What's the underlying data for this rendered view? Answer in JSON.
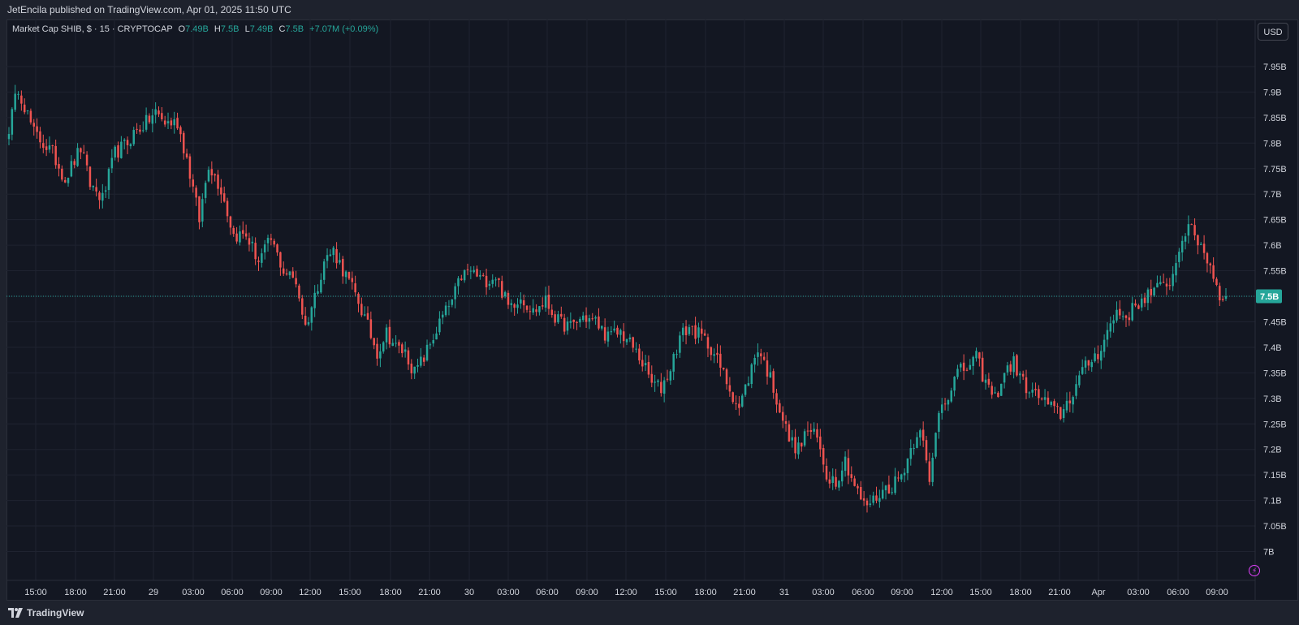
{
  "header": {
    "publisher_text": "JetEncila published on TradingView.com, Apr 01, 2025 11:50 UTC"
  },
  "legend": {
    "symbol": "Market Cap SHIB, $ · 15 · CRYPTOCAP",
    "o_label": "O",
    "o_value": "7.49B",
    "h_label": "H",
    "h_value": "7.5B",
    "l_label": "L",
    "l_value": "7.49B",
    "c_label": "C",
    "c_value": "7.5B",
    "change": "+7.07M (+0.09%)"
  },
  "currency_button": "USD",
  "footer": {
    "brand": "TradingView"
  },
  "colors": {
    "up": "#26a69a",
    "down": "#ef5350",
    "background": "#131722",
    "grid": "#1f2330",
    "text": "#d1d4dc"
  },
  "chart_data": {
    "type": "candlestick",
    "title": "Market Cap SHIB, $ · 15 · CRYPTOCAP",
    "y_unit": "B",
    "ylim": [
      6.97,
      8.01
    ],
    "y_ticks": [
      7.0,
      7.05,
      7.1,
      7.15,
      7.2,
      7.25,
      7.3,
      7.35,
      7.4,
      7.45,
      7.5,
      7.55,
      7.6,
      7.65,
      7.7,
      7.75,
      7.8,
      7.85,
      7.9,
      7.95
    ],
    "y_tick_labels": [
      "7B",
      "7.05B",
      "7.1B",
      "7.15B",
      "7.2B",
      "7.25B",
      "7.3B",
      "7.35B",
      "7.4B",
      "7.45B",
      "7.5B",
      "7.55B",
      "7.6B",
      "7.65B",
      "7.7B",
      "7.75B",
      "7.8B",
      "7.85B",
      "7.9B",
      "7.95B"
    ],
    "x_tick_labels": [
      "15:00",
      "18:00",
      "21:00",
      "29",
      "03:00",
      "06:00",
      "09:00",
      "12:00",
      "15:00",
      "18:00",
      "21:00",
      "30",
      "03:00",
      "06:00",
      "09:00",
      "12:00",
      "15:00",
      "18:00",
      "21:00",
      "31",
      "03:00",
      "06:00",
      "09:00",
      "12:00",
      "15:00",
      "18:00",
      "21:00",
      "Apr",
      "03:00",
      "06:00",
      "09:00"
    ],
    "last_price": 7.5,
    "last_price_label": "7.5B",
    "grid": true,
    "close_path": [
      [
        0,
        7.83
      ],
      [
        3,
        7.91
      ],
      [
        8,
        7.82
      ],
      [
        14,
        7.78
      ],
      [
        18,
        7.73
      ],
      [
        23,
        7.79
      ],
      [
        26,
        7.72
      ],
      [
        30,
        7.69
      ],
      [
        34,
        7.78
      ],
      [
        38,
        7.8
      ],
      [
        40,
        7.82
      ],
      [
        44,
        7.84
      ],
      [
        47,
        7.86
      ],
      [
        50,
        7.84
      ],
      [
        54,
        7.84
      ],
      [
        57,
        7.77
      ],
      [
        61,
        7.65
      ],
      [
        64,
        7.76
      ],
      [
        68,
        7.71
      ],
      [
        72,
        7.62
      ],
      [
        76,
        7.62
      ],
      [
        80,
        7.57
      ],
      [
        84,
        7.61
      ],
      [
        88,
        7.55
      ],
      [
        92,
        7.53
      ],
      [
        95,
        7.44
      ],
      [
        98,
        7.5
      ],
      [
        101,
        7.57
      ],
      [
        104,
        7.59
      ],
      [
        108,
        7.54
      ],
      [
        112,
        7.49
      ],
      [
        115,
        7.44
      ],
      [
        118,
        7.39
      ],
      [
        121,
        7.43
      ],
      [
        124,
        7.4
      ],
      [
        127,
        7.39
      ],
      [
        130,
        7.35
      ],
      [
        133,
        7.38
      ],
      [
        136,
        7.42
      ],
      [
        139,
        7.46
      ],
      [
        142,
        7.49
      ],
      [
        145,
        7.54
      ],
      [
        148,
        7.55
      ],
      [
        152,
        7.53
      ],
      [
        156,
        7.54
      ],
      [
        160,
        7.48
      ],
      [
        164,
        7.5
      ],
      [
        168,
        7.47
      ],
      [
        172,
        7.49
      ],
      [
        176,
        7.45
      ],
      [
        180,
        7.44
      ],
      [
        184,
        7.46
      ],
      [
        188,
        7.45
      ],
      [
        192,
        7.42
      ],
      [
        196,
        7.43
      ],
      [
        200,
        7.4
      ],
      [
        203,
        7.37
      ],
      [
        206,
        7.33
      ],
      [
        209,
        7.32
      ],
      [
        212,
        7.36
      ],
      [
        215,
        7.42
      ],
      [
        218,
        7.44
      ],
      [
        222,
        7.42
      ],
      [
        225,
        7.4
      ],
      [
        228,
        7.36
      ],
      [
        231,
        7.32
      ],
      [
        234,
        7.28
      ],
      [
        237,
        7.34
      ],
      [
        240,
        7.4
      ],
      [
        244,
        7.34
      ],
      [
        247,
        7.28
      ],
      [
        250,
        7.22
      ],
      [
        253,
        7.2
      ],
      [
        256,
        7.24
      ],
      [
        259,
        7.22
      ],
      [
        262,
        7.15
      ],
      [
        265,
        7.14
      ],
      [
        268,
        7.18
      ],
      [
        271,
        7.13
      ],
      [
        274,
        7.09
      ],
      [
        277,
        7.1
      ],
      [
        280,
        7.12
      ],
      [
        283,
        7.13
      ],
      [
        286,
        7.15
      ],
      [
        289,
        7.2
      ],
      [
        292,
        7.25
      ],
      [
        295,
        7.13
      ],
      [
        298,
        7.28
      ],
      [
        301,
        7.31
      ],
      [
        304,
        7.35
      ],
      [
        307,
        7.36
      ],
      [
        310,
        7.38
      ],
      [
        313,
        7.33
      ],
      [
        316,
        7.3
      ],
      [
        319,
        7.35
      ],
      [
        322,
        7.37
      ],
      [
        325,
        7.33
      ],
      [
        328,
        7.31
      ],
      [
        331,
        7.3
      ],
      [
        334,
        7.28
      ],
      [
        337,
        7.27
      ],
      [
        340,
        7.3
      ],
      [
        343,
        7.34
      ],
      [
        346,
        7.37
      ],
      [
        349,
        7.39
      ],
      [
        352,
        7.43
      ],
      [
        355,
        7.47
      ],
      [
        358,
        7.46
      ],
      [
        361,
        7.48
      ],
      [
        364,
        7.5
      ],
      [
        367,
        7.51
      ],
      [
        370,
        7.52
      ],
      [
        373,
        7.54
      ],
      [
        376,
        7.62
      ],
      [
        379,
        7.63
      ],
      [
        382,
        7.6
      ],
      [
        385,
        7.56
      ],
      [
        388,
        7.5
      ],
      [
        390,
        7.5
      ]
    ],
    "candle_count": 391
  }
}
